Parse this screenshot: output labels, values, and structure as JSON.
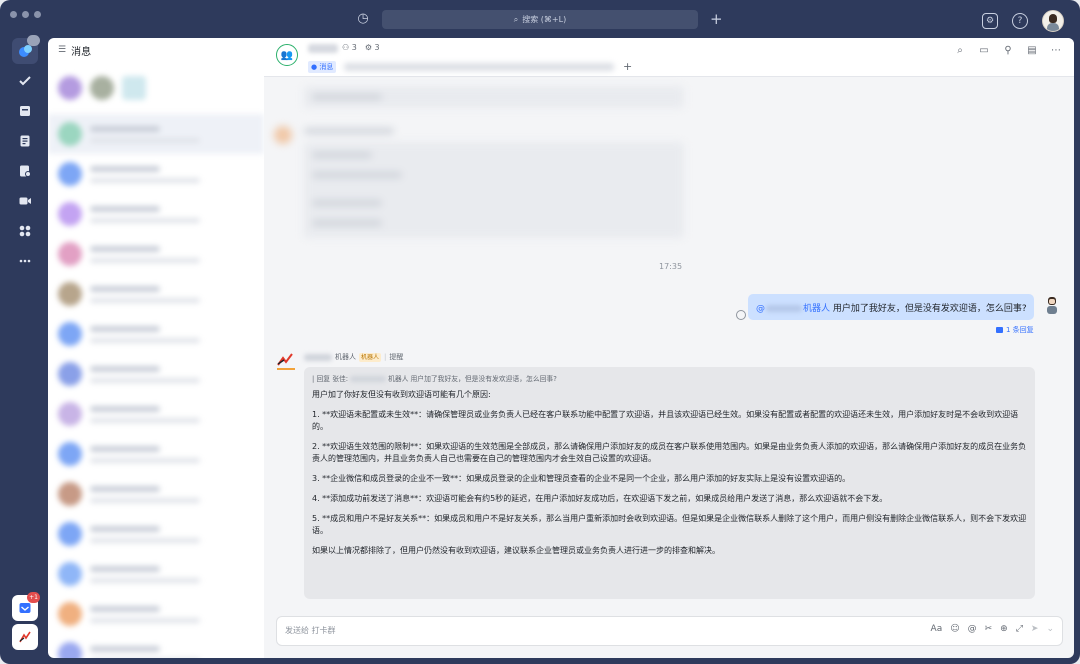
{
  "titlebar": {
    "search_placeholder": "搜索 (⌘+L)",
    "history_icon": "clock-history-icon",
    "add_icon": "plus-icon"
  },
  "rail": {
    "items": [
      "chat-icon",
      "check-icon",
      "calendar-icon",
      "docs-icon",
      "approval-icon",
      "video-icon",
      "apps-icon",
      "more-icon"
    ],
    "badge_bottom": "+1"
  },
  "list": {
    "title": "消息"
  },
  "chat": {
    "member_count": "3",
    "bot_count": "3",
    "tab_label": "消息",
    "time_divider": "17:35",
    "my_message": {
      "mention_prefix": "@",
      "mention_suffix": "机器人",
      "text": "用户加了我好友，但是没有发欢迎语，怎么回事?",
      "reply_count": "1 条回复"
    },
    "bot_message": {
      "name_suffix": "机器人",
      "tag": "机器人",
      "remind": "提醒",
      "quote_prefix": "| 回复 张佳:",
      "quote_mention": "机器人",
      "quote_text": "用户加了我好友，但是没有发欢迎语，怎么回事?",
      "intro": "用户加了你好友但没有收到欢迎语可能有几个原因:",
      "points": [
        "1. **欢迎语未配置或未生效**：请确保管理员或业务负责人已经在客户联系功能中配置了欢迎语，并且该欢迎语已经生效。如果没有配置或者配置的欢迎语还未生效，用户添加好友时是不会收到欢迎语的。",
        "2. **欢迎语生效范围的限制**：如果欢迎语的生效范围是全部成员，那么请确保用户添加好友的成员在客户联系使用范围内。如果是由业务负责人添加的欢迎语，那么请确保用户添加好友的成员在业务负责人的管理范围内，并且业务负责人自己也需要在自己的管理范围内才会生效自己设置的欢迎语。",
        "3. **企业微信和成员登录的企业不一致**：如果成员登录的企业和管理员查看的企业不是同一个企业，那么用户添加的好友实际上是没有设置欢迎语的。",
        "4. **添加成功前发送了消息**：欢迎语可能会有约5秒的延迟，在用户添加好友成功后，在欢迎语下发之前，如果成员给用户发送了消息，那么欢迎语就不会下发。",
        "5. **成员和用户不是好友关系**：如果成员和用户不是好友关系，那么当用户重新添加时会收到欢迎语。但是如果是企业微信联系人删除了这个用户，而用户侧没有删除企业微信联系人，则不会下发欢迎语。"
      ],
      "closing": "如果以上情况都排除了，但用户仍然没有收到欢迎语，建议联系企业管理员或业务负责人进行进一步的排查和解决。"
    },
    "input_placeholder": "发送给 打卡群"
  },
  "colors": {
    "window_bg": "#2e3a5c",
    "accent": "#3370ff",
    "my_bubble": "#cce0ff",
    "bot_tag": "#fdeccc"
  }
}
